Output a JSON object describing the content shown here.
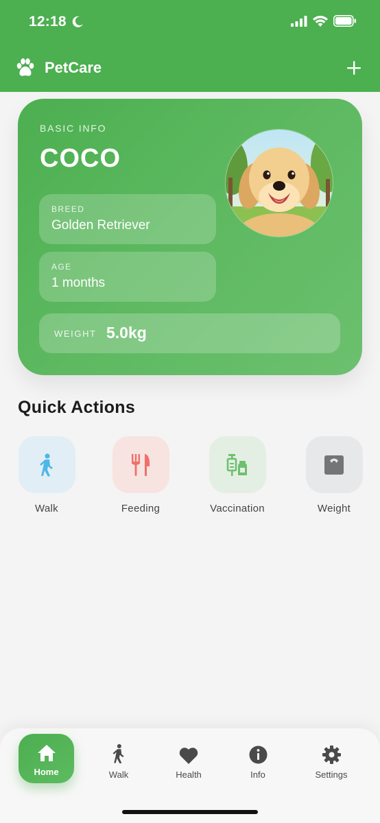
{
  "status_bar": {
    "time": "12:18"
  },
  "app_bar": {
    "title": "PetCare",
    "logo_icon": "paw-icon",
    "add_icon": "plus-icon"
  },
  "pet_card": {
    "section_label": "BASIC INFO",
    "name": "COCO",
    "breed_label": "BREED",
    "breed": "Golden Retriever",
    "age_label": "AGE",
    "age": "1 months",
    "weight_label": "WEIGHT",
    "weight": "5.0kg"
  },
  "quick_actions": {
    "title": "Quick Actions",
    "items": [
      {
        "label": "Walk",
        "icon": "walk-icon",
        "tile_color": "#e2eef5",
        "icon_color": "#4fb6e8"
      },
      {
        "label": "Feeding",
        "icon": "fork-knife-icon",
        "tile_color": "#f7e3e0",
        "icon_color": "#f0706a"
      },
      {
        "label": "Vaccination",
        "icon": "vaccine-icon",
        "tile_color": "#e3efe2",
        "icon_color": "#6cc06f"
      },
      {
        "label": "Weight",
        "icon": "scale-icon",
        "tile_color": "#e6e8ea",
        "icon_color": "#757575"
      }
    ]
  },
  "bottom_nav": {
    "items": [
      {
        "label": "Home",
        "icon": "home-icon",
        "active": true
      },
      {
        "label": "Walk",
        "icon": "walk-icon"
      },
      {
        "label": "Health",
        "icon": "heart-icon"
      },
      {
        "label": "Info",
        "icon": "info-icon"
      },
      {
        "label": "Settings",
        "icon": "gear-icon"
      }
    ]
  },
  "colors": {
    "primary": "#4caf50",
    "background": "#f4f4f4"
  }
}
